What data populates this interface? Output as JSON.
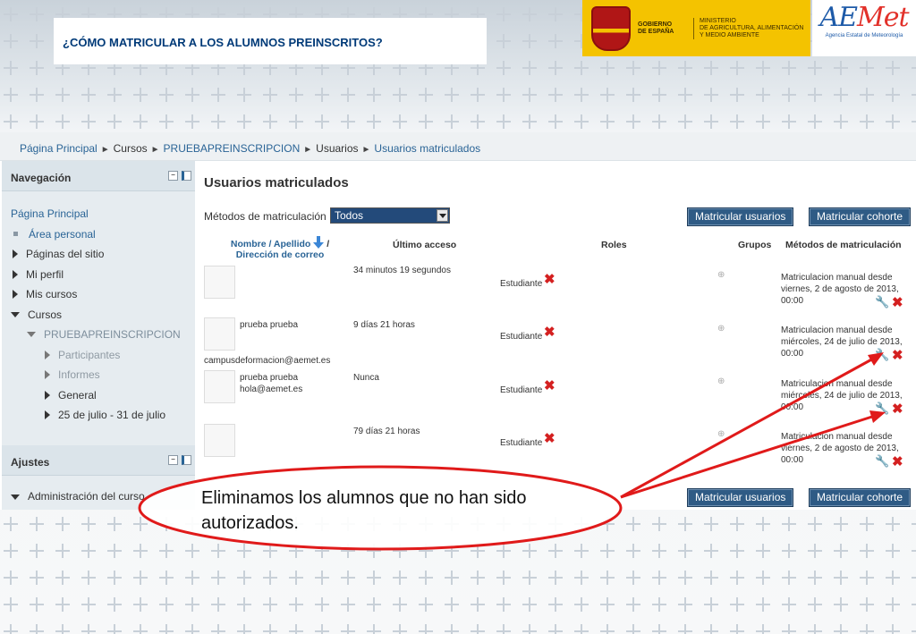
{
  "slide_title": "¿CÓMO MATRICULAR A LOS ALUMNOS PREINSCRITOS?",
  "logos": {
    "gov_line1": "GOBIERNO",
    "gov_line2": "DE ESPAÑA",
    "ministry_line1": "MINISTERIO",
    "ministry_line2": "DE AGRICULTURA, ALIMENTACIÓN",
    "ministry_line3": "Y MEDIO AMBIENTE",
    "aemet_a": "AE",
    "aemet_b": "Met",
    "aemet_sub": "Agencia Estatal de Meteorología"
  },
  "breadcrumb": {
    "home": "Página Principal",
    "courses": "Cursos",
    "course": "PRUEBAPREINSCRIPCION",
    "users": "Usuarios",
    "enrolled": "Usuarios matriculados",
    "separator": "►"
  },
  "sidebar": {
    "nav_title": "Navegación",
    "items": [
      {
        "label": "Página Principal"
      },
      {
        "label": "Área personal"
      },
      {
        "label": "Páginas del sitio"
      },
      {
        "label": "Mi perfil"
      },
      {
        "label": "Mis cursos"
      },
      {
        "label": "Cursos"
      },
      {
        "label": "PRUEBAPREINSCRIPCION"
      },
      {
        "label": "Participantes"
      },
      {
        "label": "Informes"
      },
      {
        "label": "General"
      },
      {
        "label": "25 de julio - 31 de julio"
      }
    ],
    "settings_title": "Ajustes",
    "admin_label": "Administración del curso"
  },
  "main": {
    "heading": "Usuarios matriculados",
    "methods_label": "Métodos de matriculación",
    "methods_selected": "Todos",
    "btn_enrol_users": "Matricular usuarios",
    "btn_enrol_cohort": "Matricular cohorte",
    "columns": {
      "name_part1": "Nombre / Apellido",
      "name_part2": "/",
      "email": "Dirección de correo",
      "last_access": "Último acceso",
      "roles": "Roles",
      "groups": "Grupos",
      "methods": "Métodos de matriculación"
    },
    "rows": [
      {
        "name": "",
        "email": "",
        "access": "34 minutos 19 segundos",
        "role": "Estudiante",
        "method": "Matriculacion manual desde viernes, 2 de agosto de 2013, 00:00"
      },
      {
        "name": "prueba prueba",
        "email": "campusdeformacion@aemet.es",
        "access": "9 días 21 horas",
        "role": "Estudiante",
        "method": "Matriculacion manual desde miércoles, 24 de julio de 2013, 00:00"
      },
      {
        "name": "prueba prueba",
        "email": "hola@aemet.es",
        "access": "Nunca",
        "role": "Estudiante",
        "method": "Matriculacion manual desde miércoles, 24 de julio de 2013, 00:00"
      },
      {
        "name": "",
        "email": "",
        "access": "79 días 21 horas",
        "role": "Estudiante",
        "method": "Matriculacion manual desde viernes, 2 de agosto de 2013, 00:00"
      }
    ]
  },
  "callout": {
    "line1": "Eliminamos los alumnos que no han sido",
    "line2": "autorizados."
  },
  "colors": {
    "title_text": "#003a78",
    "gov_yellow": "#f4c300",
    "button_blue": "#2f5b85",
    "annotation_red": "#e01a1a",
    "delete_red": "#d42020"
  }
}
